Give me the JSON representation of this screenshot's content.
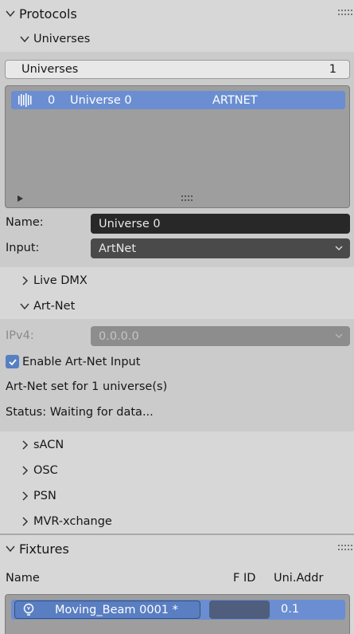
{
  "protocols": {
    "title": "Protocols",
    "universes_subpanel": "Universes",
    "universes_box": {
      "label": "Universes",
      "count": "1"
    },
    "universe_list": [
      {
        "index": "0",
        "name": "Universe 0",
        "protocol": "ARTNET"
      }
    ],
    "name_label": "Name:",
    "name_value": "Universe 0",
    "input_label": "Input:",
    "input_value": "ArtNet",
    "live_dmx": "Live DMX",
    "artnet": {
      "title": "Art-Net",
      "ipv4_label": "IPv4:",
      "ipv4_value": "0.0.0.0",
      "enable_label": "Enable Art-Net Input",
      "enabled": true,
      "set_info": "Art-Net set for 1 universe(s)",
      "status": "Status: Waiting for data..."
    },
    "sacn": "sACN",
    "osc": "OSC",
    "psn": "PSN",
    "mvr": "MVR-xchange"
  },
  "fixtures": {
    "title": "Fixtures",
    "columns": [
      "Name",
      "F ID",
      "Uni.Addr"
    ],
    "rows": [
      {
        "name": "Moving_Beam 0001 *",
        "fid": "",
        "addr": "0.1"
      }
    ]
  },
  "icons": {
    "universe_icon": "dmx-bars-icon",
    "fixture_icon": "bulb-icon"
  },
  "colors": {
    "selection": "#6a8ed1",
    "panel_bg": "#d7d7d7",
    "checkbox": "#5680c2"
  }
}
